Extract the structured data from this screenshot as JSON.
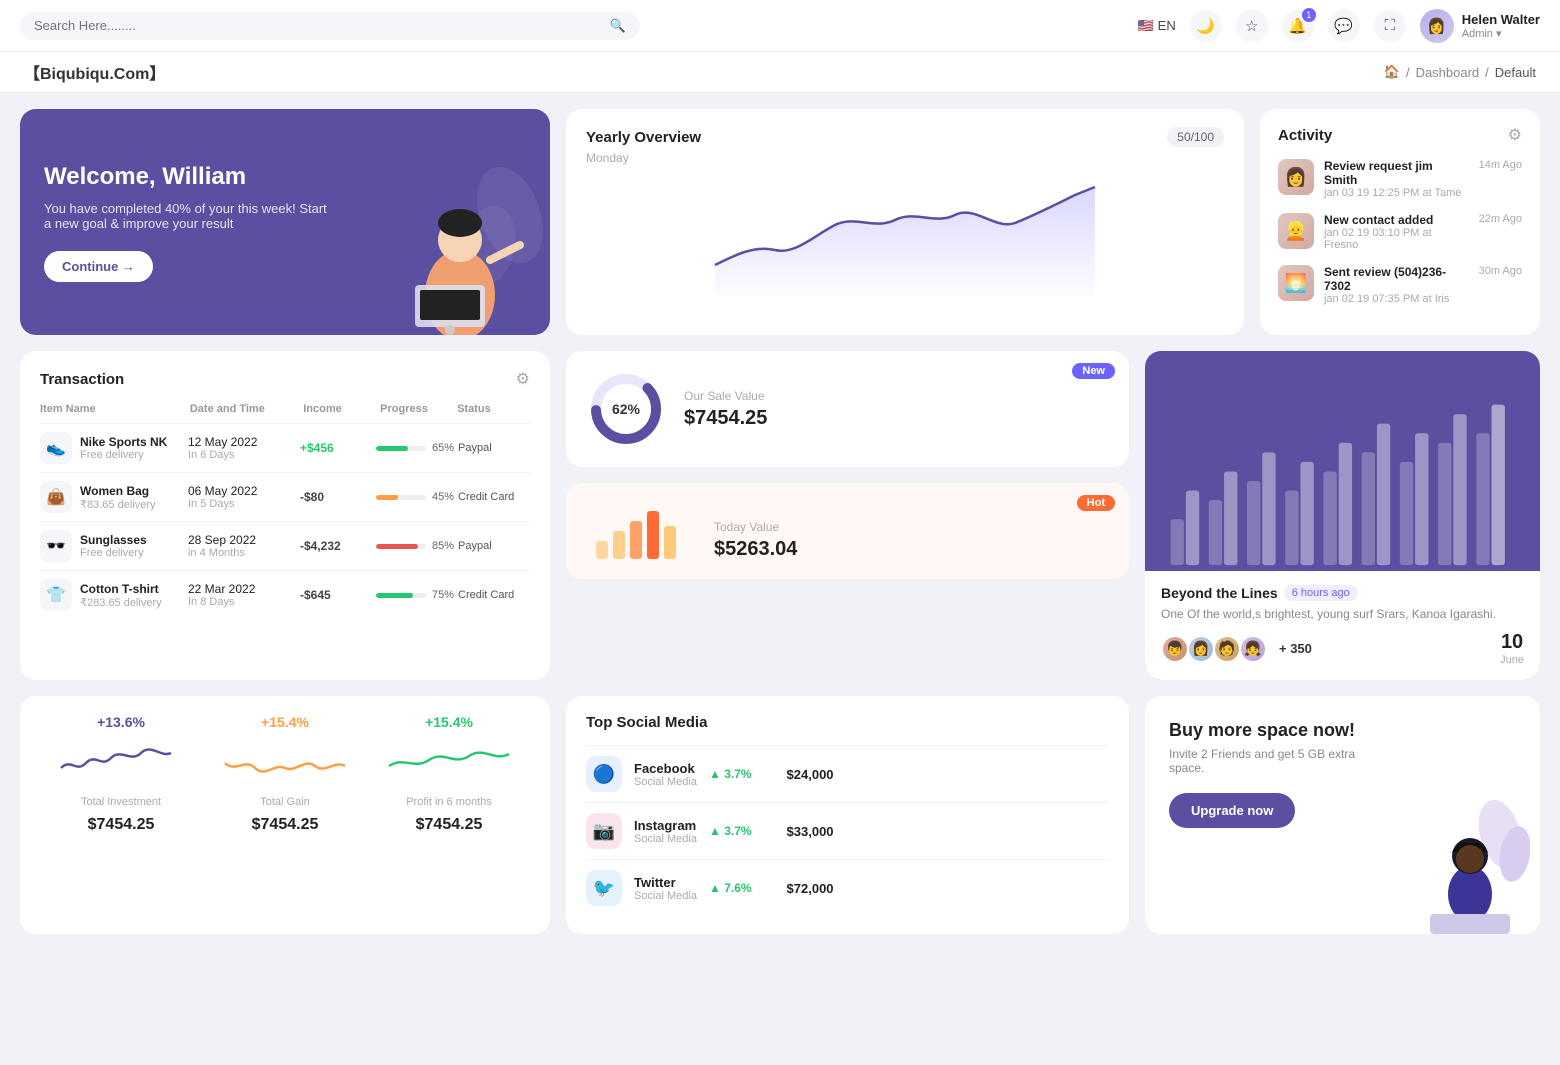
{
  "topnav": {
    "search_placeholder": "Search Here........",
    "lang": "EN",
    "notification_count": "1",
    "user_name": "Helen Walter",
    "user_role": "Admin"
  },
  "breadcrumb": {
    "brand": "【Biqubiqu.Com】",
    "home": "⌂",
    "path1": "Dashboard",
    "path2": "Default"
  },
  "welcome": {
    "title": "Welcome, William",
    "subtitle": "You have completed 40% of your this week! Start a new goal & improve your result",
    "button": "Continue →"
  },
  "yearly": {
    "title": "Yearly Overview",
    "badge": "50/100",
    "subtitle": "Monday"
  },
  "activity": {
    "title": "Activity",
    "items": [
      {
        "title": "Review request jim Smith",
        "subtitle": "jan 03 19 12:25 PM at Tame",
        "time": "14m Ago",
        "emoji": "👩"
      },
      {
        "title": "New contact added",
        "subtitle": "jan 02 19 03:10 PM at Fresno",
        "time": "22m Ago",
        "emoji": "👱"
      },
      {
        "title": "Sent review (504)236-7302",
        "subtitle": "jan 02 19 07:35 PM at Iris",
        "time": "30m Ago",
        "emoji": "🌅"
      }
    ]
  },
  "transaction": {
    "title": "Transaction",
    "headers": [
      "Item Name",
      "Date and Time",
      "Income",
      "Progress",
      "Status"
    ],
    "rows": [
      {
        "name": "Nike Sports NK",
        "sub": "Free delivery",
        "date": "12 May 2022",
        "days": "In 6 Days",
        "income": "+$456",
        "progress": 65,
        "prog_color": "#28c76f",
        "status": "Paypal",
        "emoji": "👟"
      },
      {
        "name": "Women Bag",
        "sub": "₹83.65 delivery",
        "date": "06 May 2022",
        "days": "In 5 Days",
        "income": "-$80",
        "progress": 45,
        "prog_color": "#ff9f43",
        "status": "Credit Card",
        "emoji": "👜"
      },
      {
        "name": "Sunglasses",
        "sub": "Free delivery",
        "date": "28 Sep 2022",
        "days": "in 4 Months",
        "income": "-$4,232",
        "progress": 85,
        "prog_color": "#ea5455",
        "status": "Paypal",
        "emoji": "🕶️"
      },
      {
        "name": "Cotton T-shirt",
        "sub": "₹283.65 delivery",
        "date": "22 Mar 2022",
        "days": "In 8 Days",
        "income": "-$645",
        "progress": 75,
        "prog_color": "#28c76f",
        "status": "Credit Card",
        "emoji": "👕"
      }
    ]
  },
  "sale_value": {
    "badge_new": "New",
    "donut_pct": "62%",
    "label": "Our Sale Value",
    "value": "$7454.25",
    "badge_hot": "Hot",
    "today_label": "Today Value",
    "today_value": "$5263.04"
  },
  "bar_chart": {
    "beyond_title": "Beyond the Lines",
    "beyond_time": "6 hours ago",
    "beyond_desc": "One Of the world,s brightest, young surf Srars, Kanoa Igarashi.",
    "beyond_count": "+ 350",
    "beyond_date": "10",
    "beyond_month": "June"
  },
  "mini_stats": [
    {
      "pct": "+13.6%",
      "color": "#5a4fa0",
      "label": "Total Investment",
      "value": "$7454.25"
    },
    {
      "pct": "+15.4%",
      "color": "#ff9f43",
      "label": "Total Gain",
      "value": "$7454.25"
    },
    {
      "pct": "+15.4%",
      "color": "#28c76f",
      "label": "Profit in 6 months",
      "value": "$7454.25"
    }
  ],
  "social": {
    "title": "Top Social Media",
    "items": [
      {
        "name": "Facebook",
        "type": "Social Media",
        "pct": "3.7%",
        "value": "$24,000",
        "color": "#1877f2",
        "emoji": "ⓕ"
      },
      {
        "name": "Instagram",
        "type": "Social Media",
        "pct": "3.7%",
        "value": "$33,000",
        "color": "#e1306c",
        "emoji": "📷"
      },
      {
        "name": "Twitter",
        "type": "Social Media",
        "pct": "7.6%",
        "value": "$72,000",
        "color": "#1da1f2",
        "emoji": "🐦"
      }
    ]
  },
  "upgrade": {
    "title": "Buy more space now!",
    "desc": "Invite 2 Friends and get 5 GB extra space.",
    "button": "Upgrade now"
  }
}
